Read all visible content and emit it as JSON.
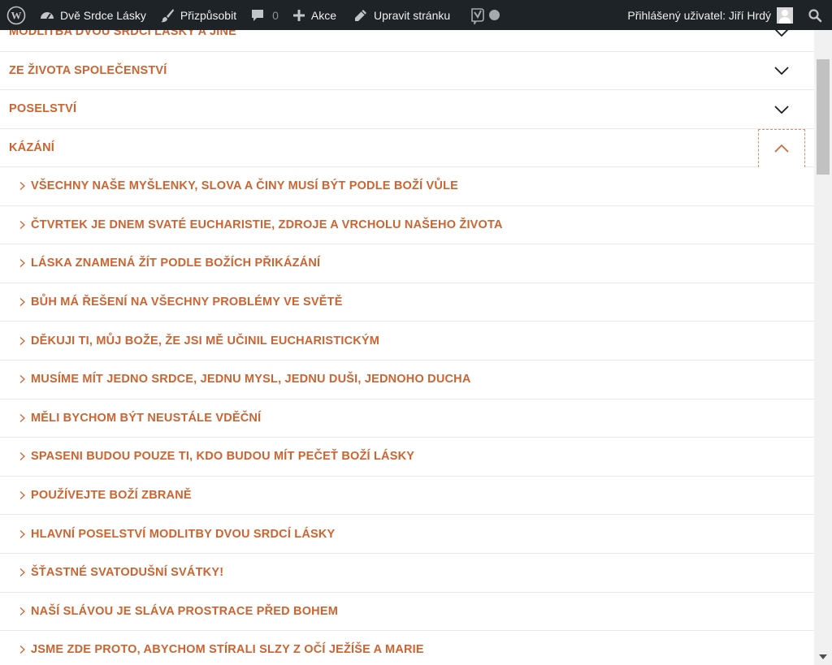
{
  "adminbar": {
    "site_name": "Dvě Srdce Lásky",
    "customize": "Přizpůsobit",
    "comments_count": "0",
    "new": "Akce",
    "edit_page": "Upravit stránku",
    "logged_in_user": "Přihlášený uživatel: Jiří Hrdý"
  },
  "menu": {
    "categories": [
      {
        "label": "Modlitba dvou srdcí lásky a jiné",
        "expanded": false
      },
      {
        "label": "Ze života společenství",
        "expanded": false
      },
      {
        "label": "Poselství",
        "expanded": false
      },
      {
        "label": "Kázání",
        "expanded": true
      }
    ],
    "subitems": [
      {
        "label": "Všechny naše myšlenky, slova a činy musí být podle Boží vůle"
      },
      {
        "label": "Čtvrtek je dnem svaté Eucharistie, zdroje a vrcholu našeho života"
      },
      {
        "label": "Láska znamená žít podle Božích přikázání"
      },
      {
        "label": "Bůh má řešení na všechny problémy ve světě"
      },
      {
        "label": "Děkuji ti, můj Bože, že jsi mě učinil eucharistickým"
      },
      {
        "label": "Musíme mít jedno srdce, jednu mysl, jednu duši, jednoho Ducha"
      },
      {
        "label": "Měli bychom být neustále vděční"
      },
      {
        "label": "Spaseni budou pouze ti, kdo budou mít pečeť Boží lásky"
      },
      {
        "label": "Používejte Boží zbraně"
      },
      {
        "label": "Hlavní poselství Modlitby dvou srdcí lásky"
      },
      {
        "label": "Šťastné svatodušní svátky!"
      },
      {
        "label": "Naší slávou je sláva prostrace před Bohem"
      },
      {
        "label": "Jsme zde proto, abychom stírali slzy z očí Ježíše a Marie"
      }
    ]
  },
  "colors": {
    "accent": "#cc6431",
    "adminbar_bg": "#1d2327"
  }
}
